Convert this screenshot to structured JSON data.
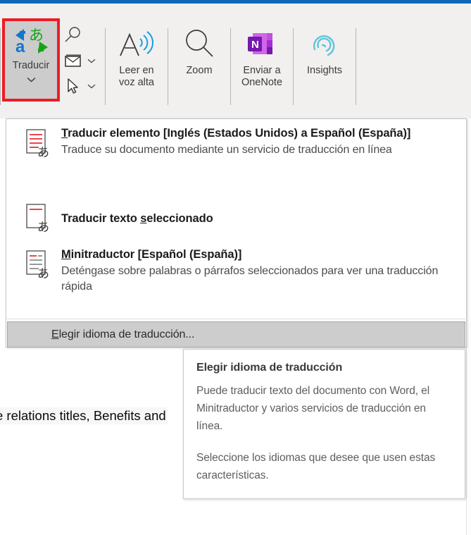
{
  "accent_color": "#1066b8",
  "ribbon": {
    "translate_button": {
      "label": "Traducir",
      "icon": "translate-icon",
      "dropdown_icon": "chevron-down-icon",
      "highlight_color": "#ec1c24",
      "selected": true
    },
    "small_buttons": [
      {
        "icon": "search-icon",
        "label": ""
      },
      {
        "icon": "envelope-icon",
        "label": "",
        "dropdown_icon": "chevron-down-icon"
      },
      {
        "icon": "cursor-icon",
        "label": "",
        "dropdown_icon": "chevron-down-icon"
      }
    ],
    "buttons": [
      {
        "label": "Leer en\nvoz alta",
        "line1": "Leer en",
        "line2": "voz alta",
        "icon": "read-aloud-icon"
      },
      {
        "label": "Zoom",
        "line1": "Zoom",
        "line2": "",
        "icon": "zoom-magnifier-icon"
      },
      {
        "label": "Enviar a\nOneNote",
        "line1": "Enviar a",
        "line2": "OneNote",
        "icon": "onenote-icon"
      },
      {
        "label": "Insights",
        "line1": "Insights",
        "line2": "",
        "icon": "insights-icon"
      }
    ]
  },
  "menu": {
    "items": [
      {
        "icon": "translate-document-icon",
        "title": "Traducir elemento [Inglés (Estados Unidos) a Español (España)]",
        "title_prefix": "T",
        "title_rest": "raducir elemento [Inglés (Estados Unidos) a Español (España)]",
        "description": "Traduce su documento mediante un servicio de traducción en línea"
      },
      {
        "icon": "translate-selection-icon",
        "title": "Traducir texto seleccionado",
        "title_prefix": "Traducir texto ",
        "title_mid": "s",
        "title_rest": "eleccionado",
        "description": ""
      },
      {
        "icon": "mini-translator-icon",
        "title": "Minitraductor [Español (España)]",
        "title_prefix": "M",
        "title_rest": "initraductor [Español (España)]",
        "description": "Deténgase sobre palabras o párrafos seleccionados para ver una traducción rápida"
      }
    ],
    "highlighted_item": {
      "label_prefix": "E",
      "label_rest": "legir idioma de traducción...",
      "label": "Elegir idioma de traducción..."
    }
  },
  "tooltip": {
    "title": "Elegir idioma de traducción",
    "paragraph1": "Puede traducir texto del documento con Word, el Minitraductor y varios servicios de traducción en línea.",
    "paragraph2": "Seleccione los idiomas que desee que usen estas características."
  },
  "document": {
    "visible_text": "e relations titles, Benefits and"
  }
}
